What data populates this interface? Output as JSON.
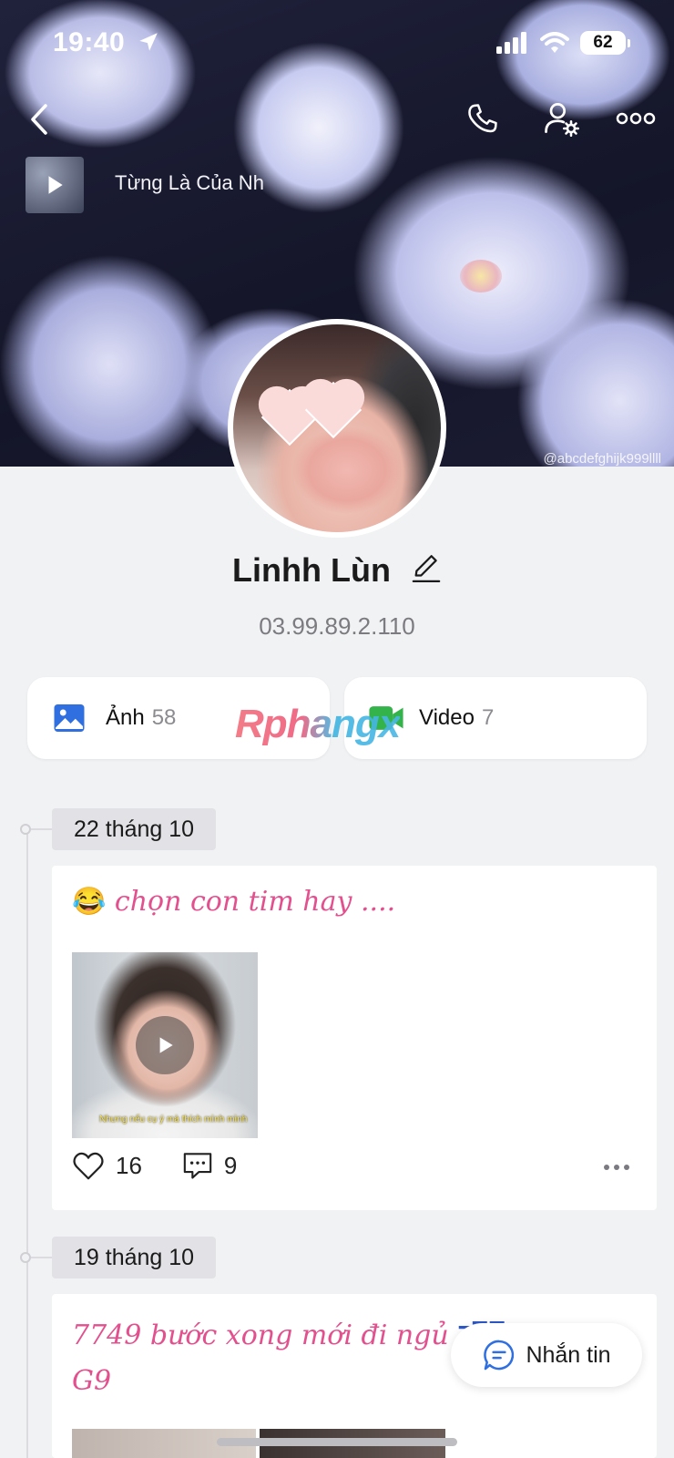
{
  "status_bar": {
    "time": "19:40",
    "battery": "62"
  },
  "cover": {
    "handle": "@abcdefghijk999llll"
  },
  "music": {
    "title": "Từng Là Của Nh"
  },
  "profile": {
    "name": "Linhh Lùn",
    "phone": "03.99.89.2.110"
  },
  "media_tabs": [
    {
      "label": "Ảnh",
      "count": "58"
    },
    {
      "label": "Video",
      "count": "7"
    }
  ],
  "watermark": "Rphangx",
  "timeline": [
    {
      "date": "22 tháng 10",
      "post": {
        "emoji": "😂",
        "text": "chọn con tim hay ....",
        "video_subtitle": "Nhưng nếu cụ ý mà thích mình mình",
        "likes": "16",
        "comments": "9"
      }
    },
    {
      "date": "19 tháng 10",
      "post": {
        "text_line1": "7749 bước xong mới đi ngủ",
        "sleep_emoji": "zZZ",
        "text_line2": "G9"
      }
    }
  ],
  "message_button": {
    "label": "Nhắn tin"
  },
  "colors": {
    "accent_pink": "#e2508e",
    "icon_blue": "#2f6fe0",
    "icon_green": "#33b34a"
  }
}
